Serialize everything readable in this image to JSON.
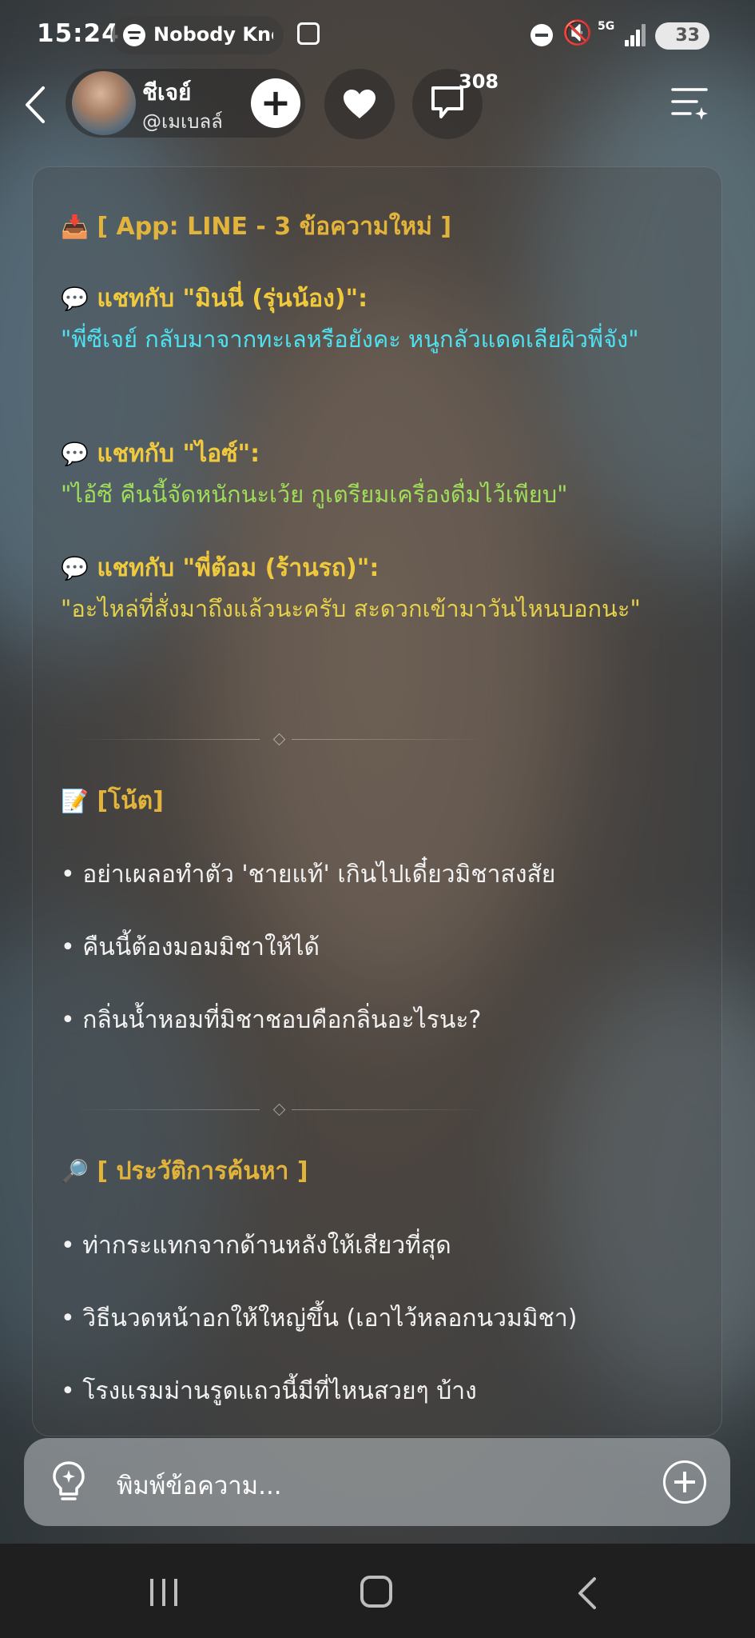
{
  "status_bar": {
    "time": "15:24",
    "media": "Nobody Kno",
    "network": "5G",
    "battery": "33"
  },
  "header": {
    "name": "ชีเจย์",
    "handle": "@เมเบลล์",
    "follow_label": "+",
    "comment_count": "308"
  },
  "panel": {
    "line_section": {
      "icon": "📥",
      "title": "[ App: LINE - 3 ข้อความใหม่ ]",
      "chats": [
        {
          "head": "แชทกับ \"มินนี่ (รุ่นน้อง)\":",
          "message": "\"พี่ซีเจย์ กลับมาจากทะเลหรือยังคะ หนูกลัวแดดเลียผิวพี่จัง\""
        },
        {
          "head": "แชทกับ \"ไอซ์\":",
          "message": "\"ไอ้ซี คืนนี้จัดหนักนะเว้ย กูเตรียมเครื่องดื่มไว้เพียบ\""
        },
        {
          "head": "แชทกับ \"พี่ต้อม (ร้านรถ)\":",
          "message": "\"อะไหล่ที่สั่งมาถึงแล้วนะครับ สะดวกเข้ามาวันไหนบอกนะ\""
        }
      ]
    },
    "note_section": {
      "icon": "📝",
      "title": "[โน้ต]",
      "items": [
        "• อย่าเผลอทำตัว 'ชายแท้' เกินไปเดี๋ยวมิชาสงสัย",
        "• คืนนี้ต้องมอมมิชาให้ได้",
        "• กลิ่นน้ำหอมที่มิชาชอบคือกลิ่นอะไรนะ?"
      ]
    },
    "search_section": {
      "icon": "🔎",
      "title": "[ ประวัติการค้นหา ]",
      "items": [
        "• ท่ากระแทกจากด้านหลังให้เสียวที่สุด",
        "• วิธีนวดหน้าอกให้ใหญ่ขึ้น (เอาไว้หลอกนวมมิชา)",
        "• โรงแรมม่านรูดแถวนี้มีที่ไหนสวยๆ บ้าง"
      ]
    }
  },
  "input": {
    "placeholder": "พิมพ์ข้อความ..."
  }
}
